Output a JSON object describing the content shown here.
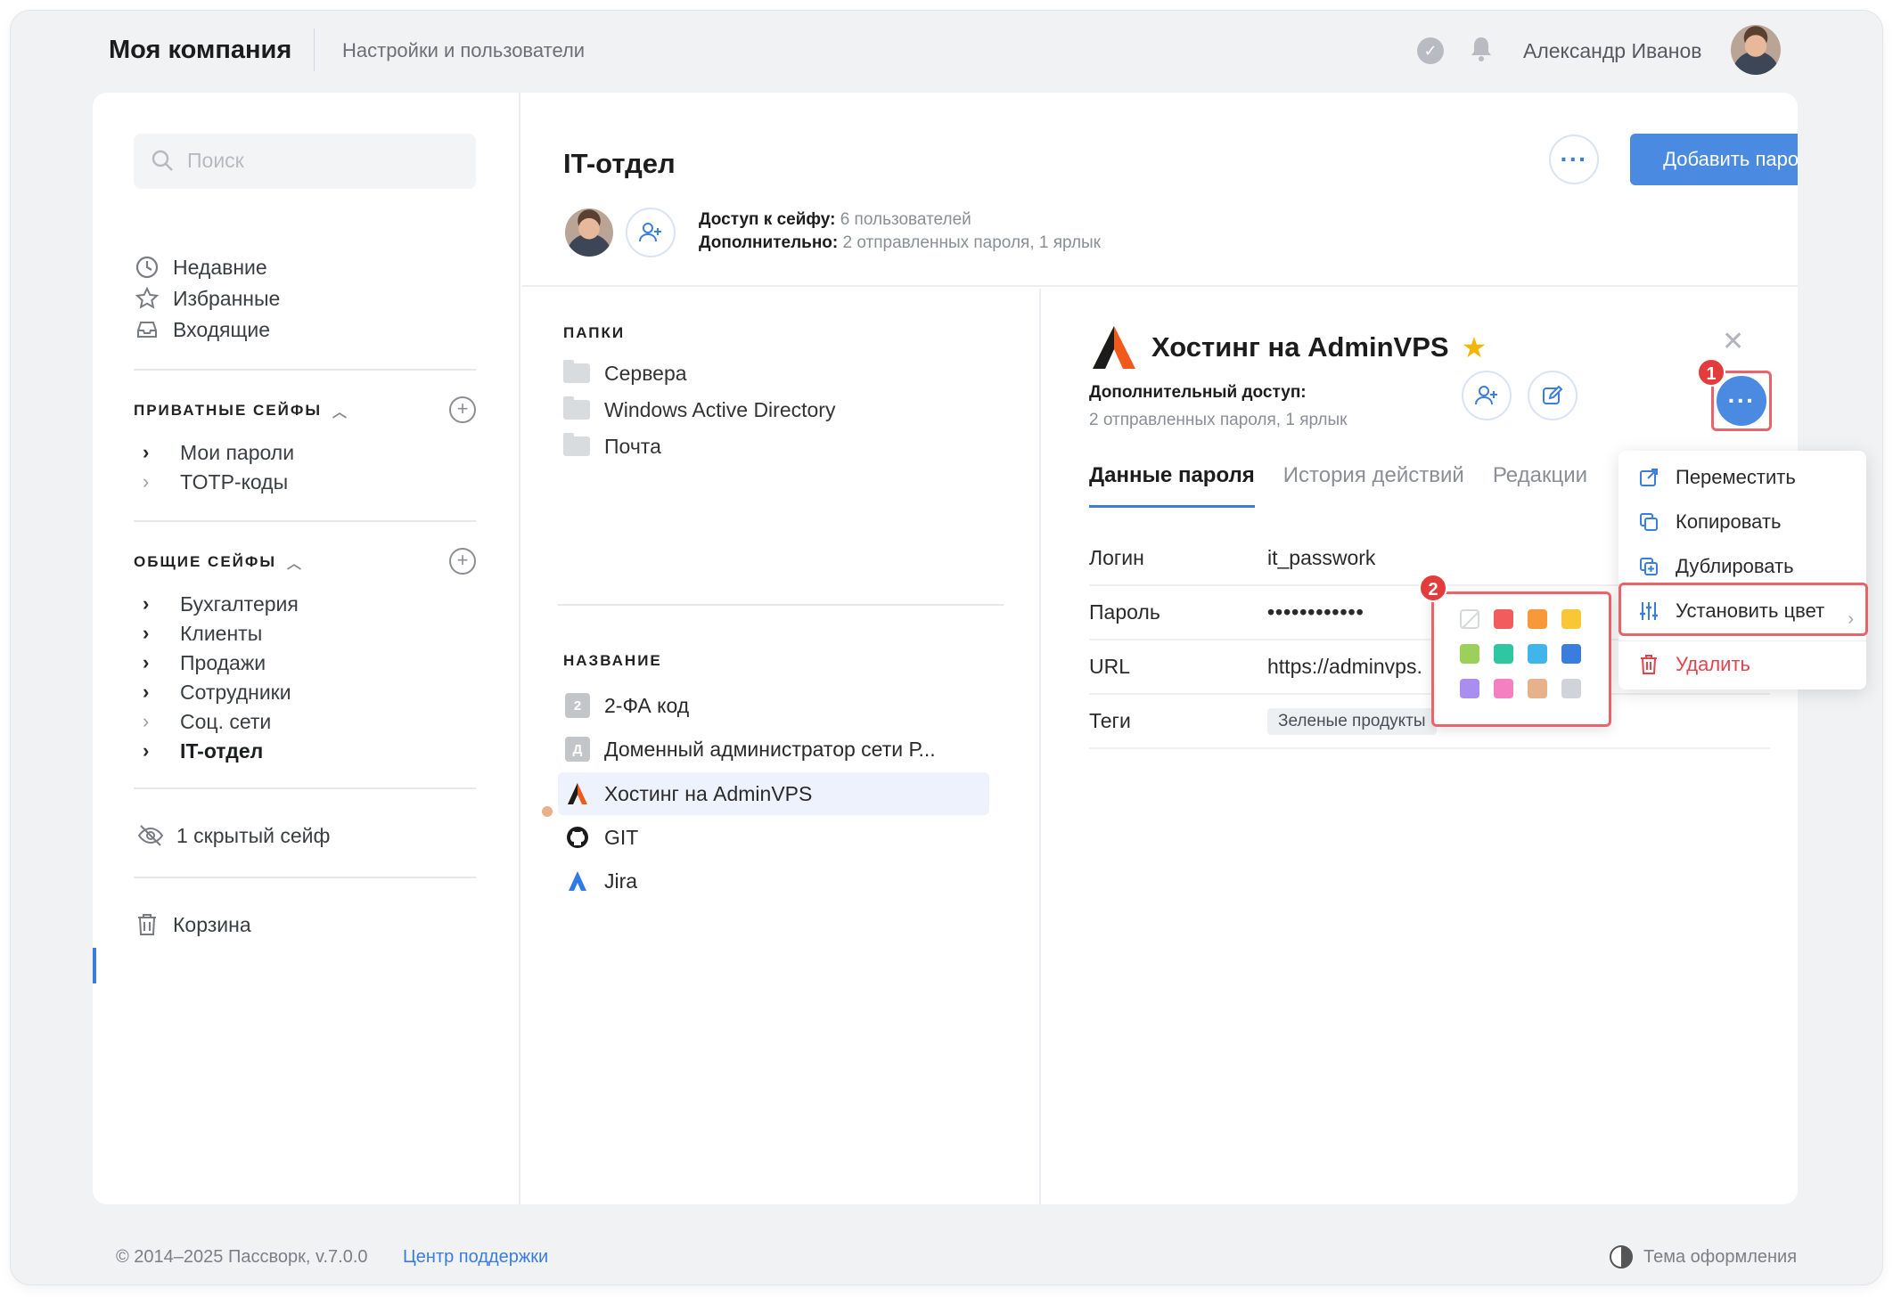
{
  "topbar": {
    "brand": "Моя компания",
    "settings_link": "Настройки и пользователи",
    "user_name": "Александр Иванов"
  },
  "sidebar": {
    "search_placeholder": "Поиск",
    "nav": [
      {
        "label": "Недавние",
        "icon": "clock-icon"
      },
      {
        "label": "Избранные",
        "icon": "star-icon"
      },
      {
        "label": "Входящие",
        "icon": "inbox-icon"
      }
    ],
    "private_section": {
      "title": "ПРИВАТНЫЕ СЕЙФЫ",
      "items": [
        {
          "label": "Мои пароли",
          "expandable": true
        },
        {
          "label": "TOTP-коды",
          "expandable": false
        }
      ]
    },
    "shared_section": {
      "title": "ОБЩИЕ СЕЙФЫ",
      "items": [
        {
          "label": "Бухгалтерия",
          "expandable": true
        },
        {
          "label": "Клиенты",
          "expandable": true
        },
        {
          "label": "Продажи",
          "expandable": true
        },
        {
          "label": "Сотрудники",
          "expandable": true
        },
        {
          "label": "Соц. сети",
          "expandable": false
        },
        {
          "label": "IT-отдел",
          "expandable": true,
          "active": true
        }
      ]
    },
    "hidden_vaults": "1 скрытый сейф",
    "trash": "Корзина"
  },
  "vault": {
    "title": "IT-отдел",
    "access_label": "Доступ к сейфу:",
    "access_value": "6 пользователей",
    "extra_label": "Дополнительно:",
    "extra_value": "2 отправленных пароля, 1 ярлык",
    "add_password_button": "Добавить пароль"
  },
  "list": {
    "folders_caption": "ПАПКИ",
    "folders": [
      "Сервера",
      "Windows Active Directory",
      "Почта"
    ],
    "names_caption": "НАЗВАНИЕ",
    "entries": [
      {
        "label": "2-ФА код",
        "badge": "2",
        "icon": "letter-badge"
      },
      {
        "label": "Доменный администратор сети Р...",
        "badge": "Д",
        "icon": "letter-badge"
      },
      {
        "label": "Хостинг на AdminVPS",
        "icon": "adminvps-logo-icon",
        "selected": true
      },
      {
        "label": "GIT",
        "icon": "github-icon"
      },
      {
        "label": "Jira",
        "icon": "jira-icon"
      }
    ]
  },
  "detail": {
    "title": "Хостинг на AdminVPS",
    "extra_access_label": "Дополнительный доступ:",
    "extra_access_value": "2 отправленных пароля, 1 ярлык",
    "tabs": [
      "Данные пароля",
      "История действий",
      "Редакции"
    ],
    "fields": [
      {
        "key": "Логин",
        "value": "it_passwork"
      },
      {
        "key": "Пароль",
        "value": "••••••••••••"
      },
      {
        "key": "URL",
        "value": "https://adminvps."
      },
      {
        "key": "Теги",
        "value": "Зеленые продукты"
      }
    ]
  },
  "menu": {
    "items": [
      {
        "label": "Переместить",
        "icon": "move-icon"
      },
      {
        "label": "Копировать",
        "icon": "copy-icon"
      },
      {
        "label": "Дублировать",
        "icon": "duplicate-icon"
      },
      {
        "label": "Установить цвет",
        "icon": "sliders-icon"
      },
      {
        "label": "Удалить",
        "icon": "trash-icon"
      }
    ]
  },
  "palette": {
    "colors": [
      "none",
      "#f25c5c",
      "#f7993a",
      "#f8c735",
      "#9bd15a",
      "#2fc7a1",
      "#3fb5ec",
      "#3b7ddd",
      "#a98ef0",
      "#f47fc1",
      "#e7b18c",
      "#d0d4da"
    ]
  },
  "annotations": {
    "step1": "1",
    "step2": "2"
  },
  "footer": {
    "copyright": "© 2014–2025 Пассворк, v.7.0.0",
    "support": "Центр поддержки",
    "theme": "Тема оформления"
  },
  "colors": {
    "accent": "#3b7ddd",
    "danger": "#e0454b",
    "highlight": "#e8646b"
  }
}
